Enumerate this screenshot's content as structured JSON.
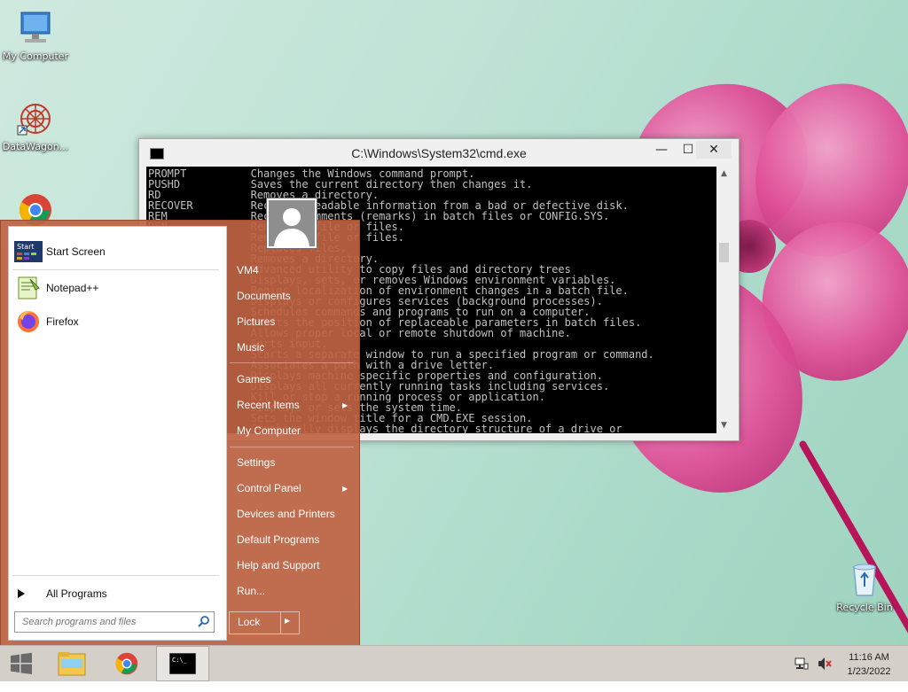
{
  "desktop": {
    "icons": [
      {
        "label": "My Computer"
      },
      {
        "label": "DataWagon..."
      },
      {
        "label": "Recycle Bin"
      }
    ]
  },
  "cmd_window": {
    "title": "C:\\Windows\\System32\\cmd.exe",
    "minimize": "—",
    "maximize": "☐",
    "close": "✕",
    "lines": [
      "PROMPT          Changes the Windows command prompt.",
      "PUSHD           Saves the current directory then changes it.",
      "RD              Removes a directory.",
      "RECOVER         Recovers readable information from a bad or defective disk.",
      "REM             Records comments (remarks) in batch files or CONFIG.SYS.",
      "REN             Renames a file or files.",
      "RENAME          Renames a file or files.",
      "REPLACE         Replaces files.",
      "RMDIR           Removes a directory.",
      "ROBOCOPY        Advanced utility to copy files and directory trees",
      "SET             Displays, sets, or removes Windows environment variables.",
      "SETLOCAL        Begins localization of environment changes in a batch file.",
      "SC              Displays or configures services (background processes).",
      "SCHTASKS        Schedules commands and programs to run on a computer.",
      "SHIFT           Shifts the position of replaceable parameters in batch files.",
      "SHUTDOWN        Allows proper local or remote shutdown of machine.",
      "SORT            Sorts input.",
      "START           Starts a separate window to run a specified program or command.",
      "SUBST           Associates a path with a drive letter.",
      "SYSTEMINFO      Displays machine specific properties and configuration.",
      "TASKLIST        Displays all currently running tasks including services.",
      "TASKKILL        Kill or stop a running process or application.",
      "TIME            Displays or sets the system time.",
      "TITLE           Sets the window title for a CMD.EXE session.",
      "TREE            Graphically displays the directory structure of a drive or"
    ]
  },
  "start_menu": {
    "pinned": [
      {
        "label": "Start Screen",
        "icon": "start-screen-icon"
      },
      {
        "label": "Notepad++",
        "icon": "notepadpp-icon"
      },
      {
        "label": "Firefox",
        "icon": "firefox-icon"
      }
    ],
    "all_programs": "All Programs",
    "search_placeholder": "Search programs and files",
    "right_items": {
      "user": "VM4",
      "documents": "Documents",
      "pictures": "Pictures",
      "music": "Music",
      "games": "Games",
      "recent_items": "Recent Items",
      "my_computer": "My Computer",
      "settings": "Settings",
      "control_panel": "Control Panel",
      "devices_printers": "Devices and Printers",
      "default_programs": "Default Programs",
      "help_support": "Help and Support",
      "run": "Run..."
    },
    "lock_label": "Lock"
  },
  "taskbar": {
    "clock_time": "11:16 AM",
    "clock_date": "1/23/2022"
  },
  "colors": {
    "start_menu_bg": "#bf6342",
    "taskbar_bg": "#d4cfc9",
    "console_bg": "#000000",
    "console_fg": "#c0c0c0"
  }
}
